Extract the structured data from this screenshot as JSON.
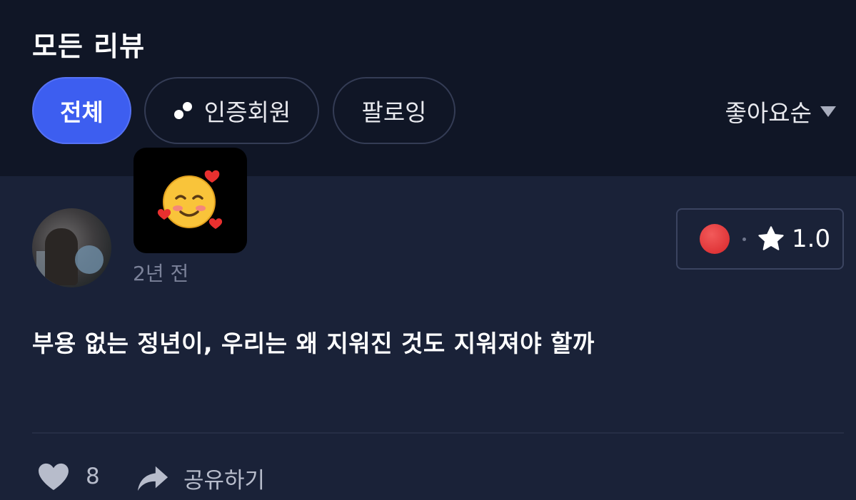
{
  "header": {
    "title": "모든 리뷰",
    "filters": [
      {
        "label": "전체",
        "active": true
      },
      {
        "label": "인증회원",
        "active": false,
        "icon": "verified-dots-icon"
      },
      {
        "label": "팔로잉",
        "active": false
      }
    ],
    "sort": {
      "label": "좋아요순",
      "icon": "caret-down-icon"
    }
  },
  "review": {
    "avatar": "profile-photo",
    "sticker": "🥰",
    "time_ago": "2년 전",
    "rating": {
      "dot_color": "#e23a3c",
      "star_icon": "star-icon",
      "value": "1.0"
    },
    "text": "부용 없는 정년이, 우리는 왜 지워진 것도 지워져야 할까",
    "like_count": "8",
    "share_label": "공유하기"
  },
  "colors": {
    "background": "#1a2238",
    "header_background": "#101626",
    "accent": "#3d5ef0"
  }
}
